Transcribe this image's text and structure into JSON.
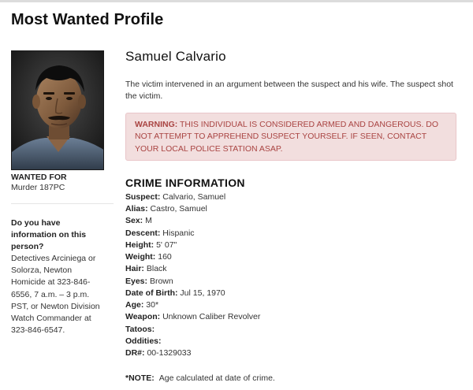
{
  "page": {
    "title": "Most Wanted Profile"
  },
  "profile": {
    "photo_icon": "suspect-photo",
    "wanted_for_label": "WANTED FOR",
    "wanted_for_value": "Murder 187PC",
    "contact_question": "Do you have information on this person?",
    "contact_text": "Detectives Arciniega or Solorza, Newton Homicide at 323-846-6556, 7 a.m. – 3 p.m. PST, or Newton Division Watch Commander at 323-846-6547."
  },
  "suspect": {
    "name": "Samuel Calvario",
    "summary": "The victim intervened in an argument between the suspect and his wife. The suspect shot the victim."
  },
  "warning": {
    "strong": "WARNING:",
    "text": " THIS INDIVIDUAL IS CONSIDERED ARMED AND DANGEROUS. DO NOT ATTEMPT TO APPREHEND SUSPECT YOURSELF. IF SEEN, CONTACT YOUR LOCAL POLICE STATION ASAP.",
    "colors": {
      "background": "#f2dede",
      "border": "#e9c6c9",
      "text": "#a94442"
    }
  },
  "crime_info": {
    "heading": "CRIME INFORMATION",
    "rows": [
      {
        "key": "Suspect:",
        "value": "Calvario, Samuel"
      },
      {
        "key": "Alias:",
        "value": "Castro, Samuel"
      },
      {
        "key": "Sex:",
        "value": "M"
      },
      {
        "key": "Descent:",
        "value": "Hispanic"
      },
      {
        "key": "Height:",
        "value": "5' 07\""
      },
      {
        "key": "Weight:",
        "value": "160"
      },
      {
        "key": "Hair:",
        "value": "Black"
      },
      {
        "key": "Eyes:",
        "value": "Brown"
      },
      {
        "key": "Date of Birth:",
        "value": "Jul 15, 1970"
      },
      {
        "key": "Age:",
        "value": "30*"
      },
      {
        "key": "Weapon:",
        "value": "Unknown Caliber Revolver"
      },
      {
        "key": "Tatoos:",
        "value": ""
      },
      {
        "key": "Oddities:",
        "value": ""
      },
      {
        "key": "DR#:",
        "value": "00-1329033"
      }
    ]
  },
  "note": {
    "key": "*NOTE:",
    "text": "Age calculated at date of crime."
  }
}
